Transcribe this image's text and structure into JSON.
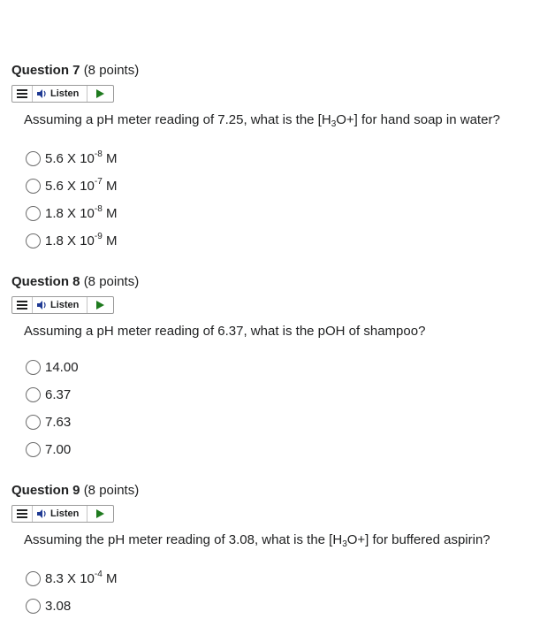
{
  "listen_label": "Listen",
  "icons": {
    "menu": "menu-icon",
    "speaker": "speaker-icon",
    "play": "play-icon"
  },
  "questions": [
    {
      "number_label": "Question 7",
      "points_label": "(8 points)",
      "prompt_before": "Assuming a pH meter reading of 7.25, what is the [H",
      "prompt_sub": "3",
      "prompt_after": "O+] for hand soap in water?",
      "options": [
        {
          "base": "5.6 X 10",
          "exp": "-8",
          "unit": " M"
        },
        {
          "base": "5.6 X 10",
          "exp": "-7",
          "unit": " M"
        },
        {
          "base": "1.8 X 10",
          "exp": "-8",
          "unit": " M"
        },
        {
          "base": "1.8 X 10",
          "exp": "-9",
          "unit": " M"
        }
      ]
    },
    {
      "number_label": "Question 8",
      "points_label": "(8 points)",
      "prompt": "Assuming a pH meter reading of 6.37, what is the pOH of shampoo?",
      "options": [
        {
          "text": "14.00"
        },
        {
          "text": "6.37"
        },
        {
          "text": "7.63"
        },
        {
          "text": "7.00"
        }
      ]
    },
    {
      "number_label": "Question 9",
      "points_label": "(8 points)",
      "prompt_before": "Assuming the pH meter reading of 3.08, what is the [H",
      "prompt_sub": "3",
      "prompt_after": "O+] for buffered aspirin?",
      "options": [
        {
          "base": "8.3 X 10",
          "exp": "-4",
          "unit": " M"
        },
        {
          "text": "3.08"
        }
      ]
    }
  ]
}
